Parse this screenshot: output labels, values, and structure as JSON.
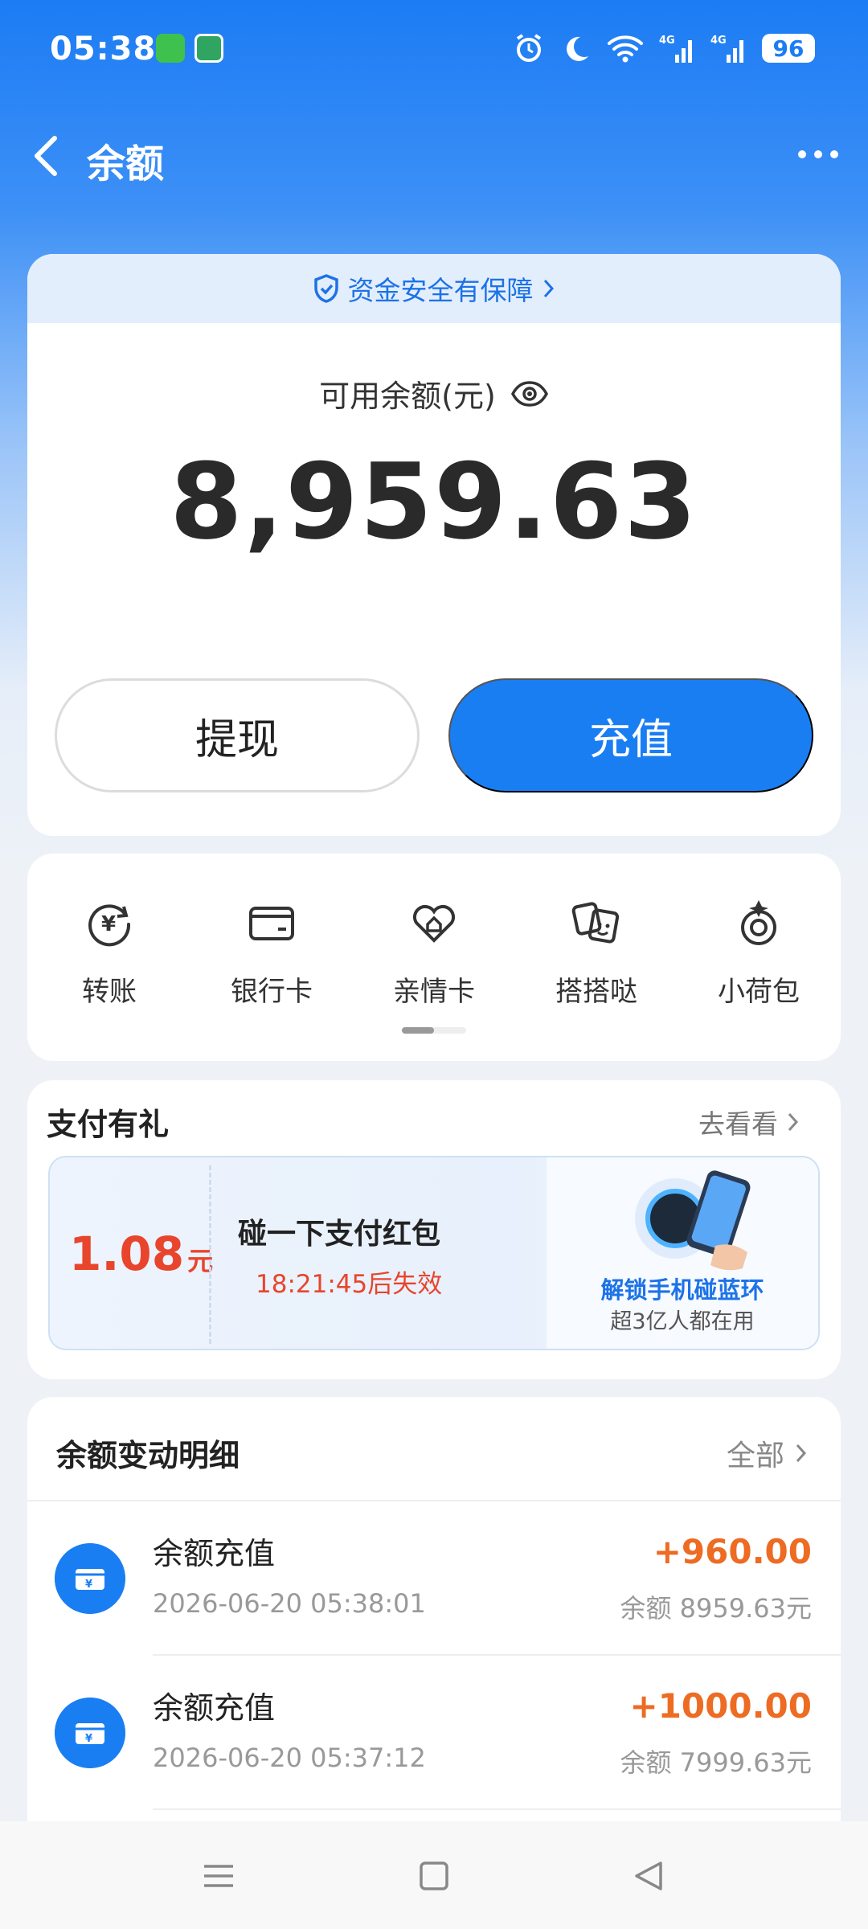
{
  "status_bar": {
    "time": "05:38",
    "battery": "96",
    "icons": [
      "message-app-icon",
      "grain-app-icon",
      "alarm-icon",
      "moon-icon",
      "wifi-icon",
      "signal-4g-icon",
      "signal-4g-icon",
      "battery-icon"
    ]
  },
  "header": {
    "title": "余额",
    "back_icon": "chevron-left-icon",
    "more_icon": "more-dots-icon"
  },
  "balance": {
    "safety_text": "资金安全有保障",
    "label": "可用余额(元)",
    "amount": "8,959.63",
    "withdraw_label": "提现",
    "recharge_label": "充值"
  },
  "actions": [
    {
      "label": "转账",
      "icon": "transfer-yuan-icon"
    },
    {
      "label": "银行卡",
      "icon": "bank-card-icon"
    },
    {
      "label": "亲情卡",
      "icon": "family-card-icon"
    },
    {
      "label": "搭搭哒",
      "icon": "cards-icon"
    },
    {
      "label": "小荷包",
      "icon": "purse-icon"
    }
  ],
  "promo": {
    "title": "支付有礼",
    "more": "去看看",
    "coupon": {
      "amount": "1.08",
      "unit": "元",
      "name": "碰一下支付红包",
      "expire": "18:21:45后失效",
      "visual_title": "解锁手机碰蓝环",
      "visual_sub": "超3亿人都在用"
    }
  },
  "transactions": {
    "title": "余额变动明细",
    "all_label": "全部",
    "items": [
      {
        "name": "余额充值",
        "time": "2026-06-20 05:38:01",
        "amount": "+960.00",
        "balance": "余额 8959.63元"
      },
      {
        "name": "余额充值",
        "time": "2026-06-20 05:37:12",
        "amount": "+1000.00",
        "balance": "余额 7999.63元"
      }
    ]
  },
  "colors": {
    "primary": "#1a7ef3",
    "amount_orange": "#ed6b22",
    "coupon_red": "#e8452c"
  }
}
